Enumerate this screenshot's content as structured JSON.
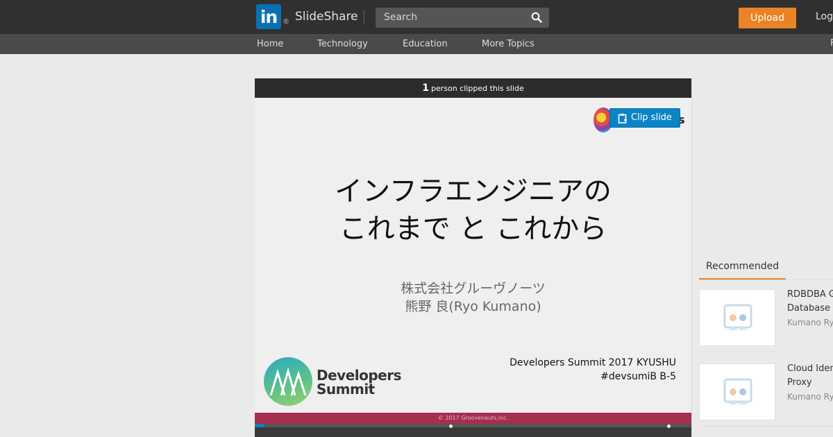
{
  "header": {
    "logo_text": "in",
    "registered_mark": "®",
    "brand": "SlideShare",
    "search_placeholder": "Search",
    "upload_label": "Upload",
    "login_label": "Log"
  },
  "nav": {
    "items": [
      "Home",
      "Technology",
      "Education",
      "More Topics"
    ],
    "edge_char": "F"
  },
  "clip_bar": {
    "count": "1",
    "text": "person clipped this slide"
  },
  "clip_button_label": "Clip slide",
  "slide": {
    "title_line1": "インフラエンジニアの",
    "title_line2": "これまで と これから",
    "company": "株式会社グルーヴノーツ",
    "speaker": "熊野 良(Ryo Kumano)",
    "event_line1": "Developers Summit 2017 KYUSHU",
    "event_line2": "#devsumiB B-5",
    "dev_logo_line1": "Developers",
    "dev_logo_line2": "Summit",
    "corner_text": "s",
    "copyright": "© 2017 Groovenauts,Inc."
  },
  "player": {
    "progress": 0.02
  },
  "recommended": {
    "tab_label": "Recommended",
    "items": [
      {
        "title": "RDBDBA G\nDatabase",
        "author": "Kumano Ry"
      },
      {
        "title": "Cloud Iden\nProxy",
        "author": "Kumano Ry"
      }
    ]
  },
  "colors": {
    "header_bg": "#303030",
    "accent_orange": "#e98325",
    "clip_blue": "#0b84c6",
    "linkedin_blue": "#0b6fb3",
    "slide_footer": "#a52e51"
  }
}
